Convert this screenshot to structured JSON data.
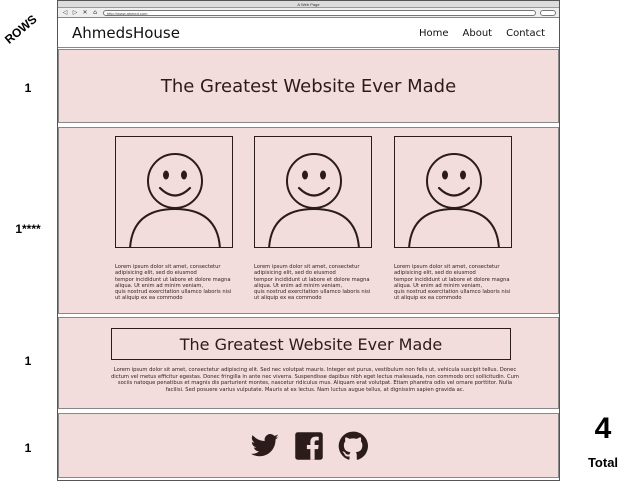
{
  "annotations": {
    "rows_label": "ROWS",
    "row_counts": [
      "1",
      "1****",
      "1",
      "1"
    ],
    "total_number": "4",
    "total_label": "Total"
  },
  "browser": {
    "title": "A Web Page",
    "url": "http://www.ahmed.com"
  },
  "navbar": {
    "brand": "AhmedsHouse",
    "links": [
      "Home",
      "About",
      "Contact"
    ]
  },
  "hero": {
    "title": "The Greatest Website Ever Made"
  },
  "cards": [
    {
      "text": "Lorem ipsum dolor sit amet, consectetur\nadipisicing elit, sed do eiusmod\ntempor incididunt ut labore et dolore magna\naliqua. Ut enim ad minim veniam,\nquis nostrud exercitation ullamco laboris nisi\nut aliquip ex ea commodo"
    },
    {
      "text": "Lorem ipsum dolor sit amet, consectetur\nadipisicing elit, sed do eiusmod\ntempor incididunt ut labore et dolore magna\naliqua. Ut enim ad minim veniam,\nquis nostrud exercitation ullamco laboris nisi\nut aliquip ex ea commodo"
    },
    {
      "text": "Lorem ipsum dolor sit amet, consectetur\nadipisicing elit, sed do eiusmod\ntempor incididunt ut labore et dolore magna\naliqua. Ut enim ad minim veniam,\nquis nostrud exercitation ullamco laboris nisi\nut aliquip ex ea commodo"
    }
  ],
  "feature": {
    "title": "The Greatest Website Ever Made",
    "paragraph": "Lorem ipsum dolor sit amet, consectetur adipiscing elit. Sed nec volutpat mauris. Integer est purus, vestibulum non felis ut, vehicula suscipit tellus. Donec dictum vel metus efficitur egestas. Donec fringilla in ante nec viverra. Suspendisse dapibus nibh eget lectus malesuada, non commodo orci sollicitudin. Cum sociis natoque penatibus et magnis dis parturient montes, nascetur ridiculus mus. Aliquam erat volutpat. Etiam pharetra odio vel ornare porttitor. Nulla facilisi. Sed posuere varius vulputate. Mauris at ex lectus. Nam luctus augue tellus, at dignissim sapien gravida ac."
  },
  "footer": {
    "icons": [
      "twitter-icon",
      "facebook-icon",
      "github-icon"
    ]
  }
}
